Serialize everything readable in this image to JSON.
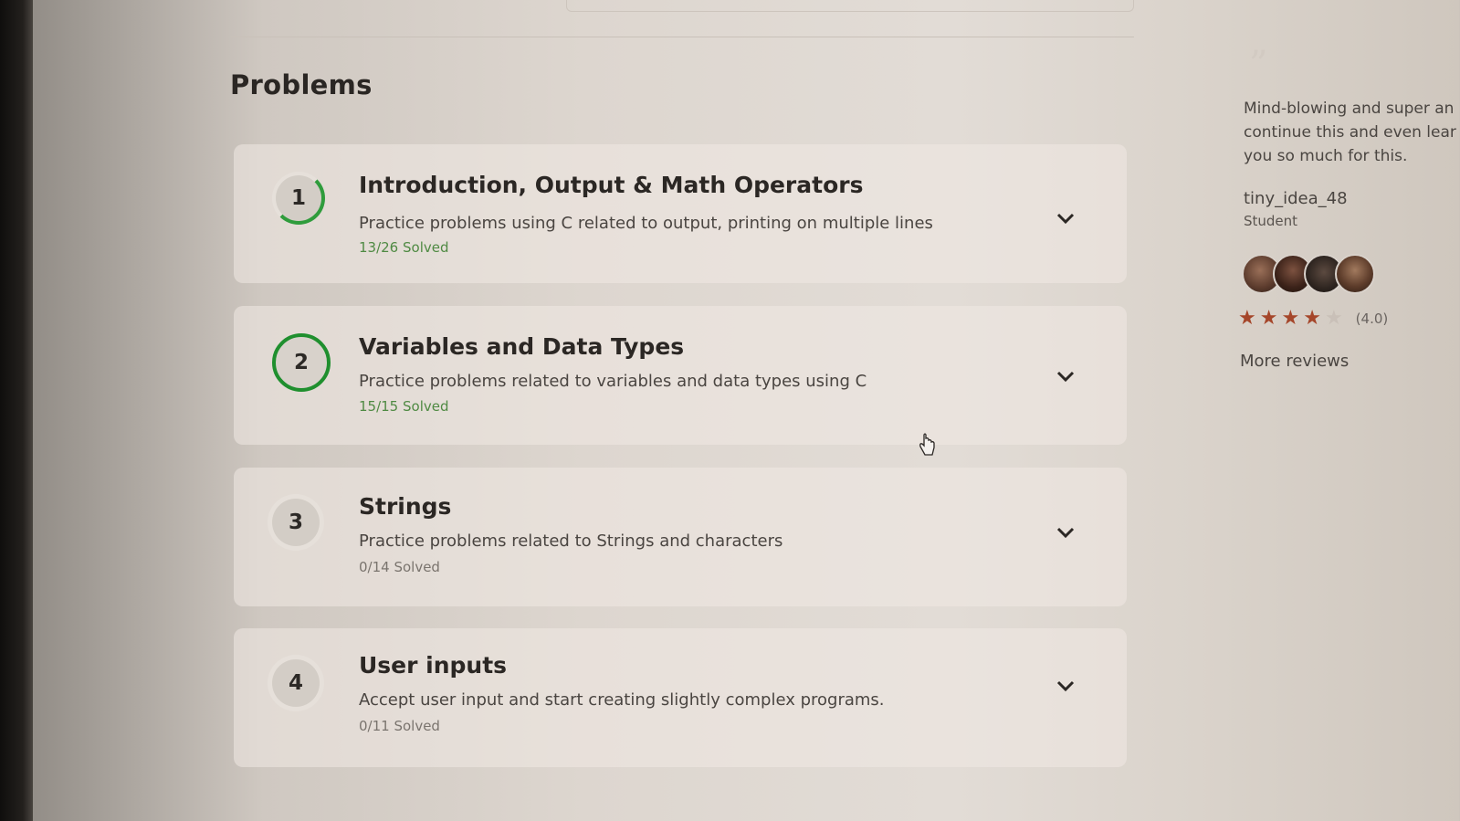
{
  "section_title": "Problems",
  "problems": [
    {
      "number": "1",
      "title": "Introduction, Output & Math Operators",
      "description": "Practice problems using C related to output, printing on multiple lines",
      "progress": "13/26 Solved",
      "solved_fraction": 0.5
    },
    {
      "number": "2",
      "title": "Variables and Data Types",
      "description": "Practice problems related to variables and data types using C",
      "progress": "15/15 Solved",
      "solved_fraction": 1.0
    },
    {
      "number": "3",
      "title": "Strings",
      "description": "Practice problems related to Strings and characters",
      "progress": "0/14 Solved",
      "solved_fraction": 0.0
    },
    {
      "number": "4",
      "title": "User inputs",
      "description": "Accept user input and start creating slightly complex programs.",
      "progress": "0/11 Solved",
      "solved_fraction": 0.0
    }
  ],
  "review": {
    "quote_mark": "”",
    "lines": [
      "Mind-blowing and super an",
      "continue this and even lear",
      "you so much for this."
    ],
    "reviewer_name": "tiny_idea_48",
    "reviewer_role": "Student",
    "rating": 4.0,
    "rating_label": "(4.0)",
    "more_reviews_label": "More reviews"
  },
  "colors": {
    "progress_green": "#2f9c3c",
    "complete_green": "#1f8f2e",
    "star_color": "#a5462a"
  },
  "icons": {
    "expand": "chevron-down-icon",
    "star": "star-icon",
    "cursor": "hand-pointer-icon"
  }
}
